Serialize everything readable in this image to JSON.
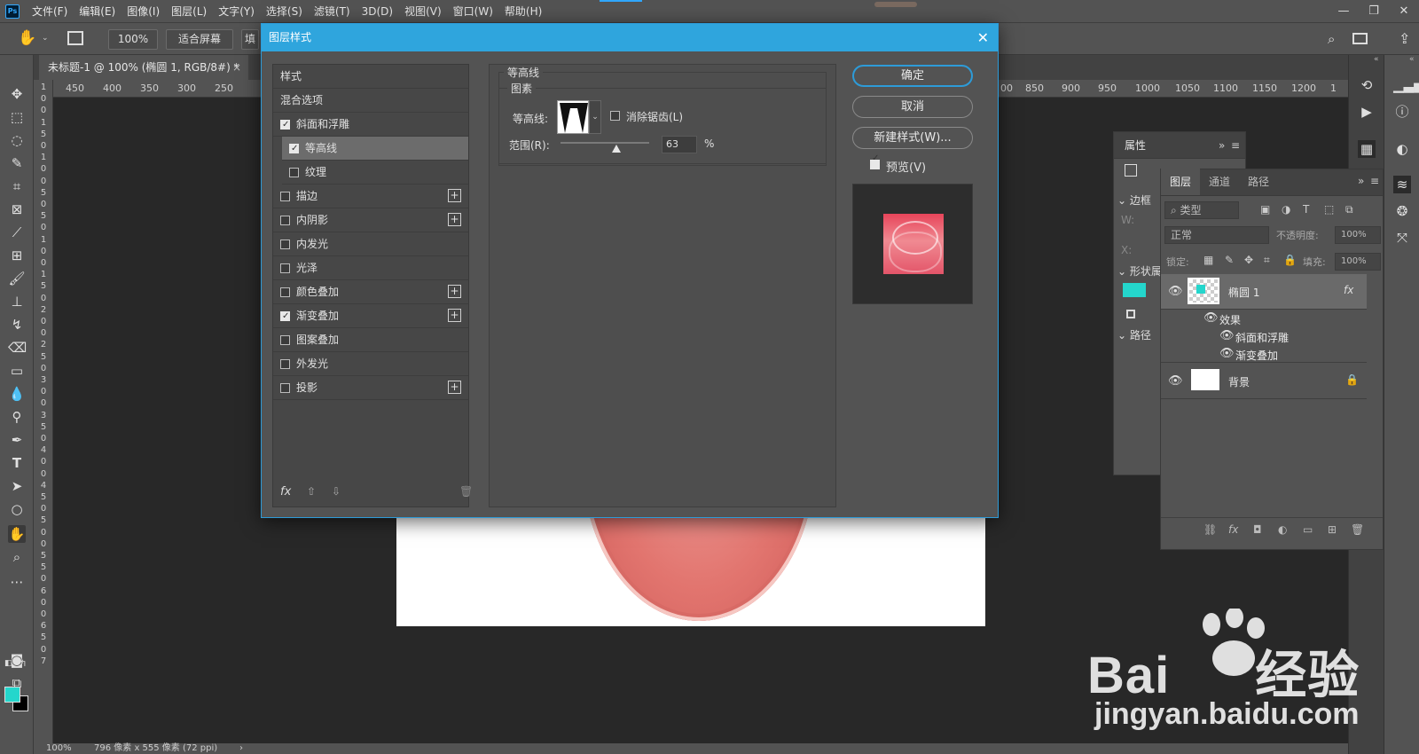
{
  "app": {
    "logo": "Ps"
  },
  "menu": [
    "文件(F)",
    "编辑(E)",
    "图像(I)",
    "图层(L)",
    "文字(Y)",
    "选择(S)",
    "滤镜(T)",
    "3D(D)",
    "视图(V)",
    "窗口(W)",
    "帮助(H)"
  ],
  "window_controls": {
    "minimize": "—",
    "restore": "❐",
    "close": "✕"
  },
  "options": {
    "zoom": "100%",
    "fit_screen": "适合屏幕",
    "fill_screen": "填"
  },
  "document": {
    "tab_title": "未标题-1 @ 100% (椭圆 1, RGB/8#) *",
    "close": "×"
  },
  "ruler_top_left": [
    "450",
    "400",
    "350",
    "300",
    "250"
  ],
  "ruler_top_right": [
    "00",
    "850",
    "900",
    "950",
    "1000",
    "1050",
    "1100",
    "1150",
    "1200",
    "1"
  ],
  "ruler_left": [
    "1",
    "0",
    "0",
    "1",
    "5",
    "0",
    "1",
    "0",
    "0",
    "5",
    "0",
    "5",
    "0",
    "1",
    "0",
    "0",
    "1",
    "5",
    "0",
    "2",
    "0",
    "0",
    "2",
    "5",
    "0",
    "3",
    "0",
    "0",
    "3",
    "5",
    "0",
    "4",
    "0",
    "0",
    "4",
    "5",
    "0",
    "5",
    "0",
    "0",
    "5",
    "5",
    "0",
    "6",
    "0",
    "0",
    "6",
    "5",
    "0",
    "7"
  ],
  "status": {
    "zoom": "100%",
    "size": "796 像素 x 555 像素 (72 ppi)",
    "arrow": "›"
  },
  "colors": {
    "foreground": "#24d6cc",
    "background": "#000000",
    "dialog_accent": "#2fa5dd"
  },
  "dialog": {
    "title": "图层样式",
    "close": "✕",
    "styles": [
      {
        "label": "样式",
        "checkbox": false,
        "checked": false,
        "plus": false
      },
      {
        "label": "混合选项",
        "checkbox": false,
        "checked": false,
        "plus": false
      },
      {
        "label": "斜面和浮雕",
        "checkbox": true,
        "checked": true,
        "plus": false
      },
      {
        "label": "等高线",
        "checkbox": true,
        "checked": true,
        "plus": false,
        "sub": true,
        "selected": true
      },
      {
        "label": "纹理",
        "checkbox": true,
        "checked": false,
        "plus": false,
        "sub": true
      },
      {
        "label": "描边",
        "checkbox": true,
        "checked": false,
        "plus": true
      },
      {
        "label": "内阴影",
        "checkbox": true,
        "checked": false,
        "plus": true
      },
      {
        "label": "内发光",
        "checkbox": true,
        "checked": false,
        "plus": false
      },
      {
        "label": "光泽",
        "checkbox": true,
        "checked": false,
        "plus": false
      },
      {
        "label": "颜色叠加",
        "checkbox": true,
        "checked": false,
        "plus": true
      },
      {
        "label": "渐变叠加",
        "checkbox": true,
        "checked": true,
        "plus": true
      },
      {
        "label": "图案叠加",
        "checkbox": true,
        "checked": false,
        "plus": false
      },
      {
        "label": "外发光",
        "checkbox": true,
        "checked": false,
        "plus": false
      },
      {
        "label": "投影",
        "checkbox": true,
        "checked": false,
        "plus": true
      }
    ],
    "footer": {
      "fx": "fx",
      "up": "⇧",
      "down": "⇩",
      "delete": "🗑"
    },
    "section_title": "等高线",
    "group_title": "图素",
    "contour_label": "等高线:",
    "antialias_label": "消除锯齿(L)",
    "range_label": "范围(R):",
    "range_value": "63",
    "range_unit": "%",
    "range_fraction": 0.63,
    "buttons": {
      "ok": "确定",
      "cancel": "取消",
      "new_style": "新建样式(W)..."
    },
    "preview_label": "预览(V)"
  },
  "properties": {
    "title": "属性",
    "section_border": "边框",
    "w_label": "W:",
    "x_label": "X:",
    "section_shape": "形状属",
    "section_path": "路径"
  },
  "layers": {
    "tabs": [
      "图层",
      "通道",
      "路径"
    ],
    "filter_placeholder": "类型",
    "blend_mode": "正常",
    "opacity_label": "不透明度:",
    "opacity_value": "100%",
    "lock_label": "锁定:",
    "fill_label": "填充:",
    "fill_value": "100%",
    "items": [
      {
        "name": "椭圆 1",
        "fx": "fx"
      },
      {
        "name": "效果"
      },
      {
        "name": "斜面和浮雕"
      },
      {
        "name": "渐变叠加"
      },
      {
        "name": "背景"
      }
    ]
  },
  "watermark": {
    "brand": "Bai",
    "brand_suffix": "经验",
    "url": "jingyan.baidu.com"
  }
}
